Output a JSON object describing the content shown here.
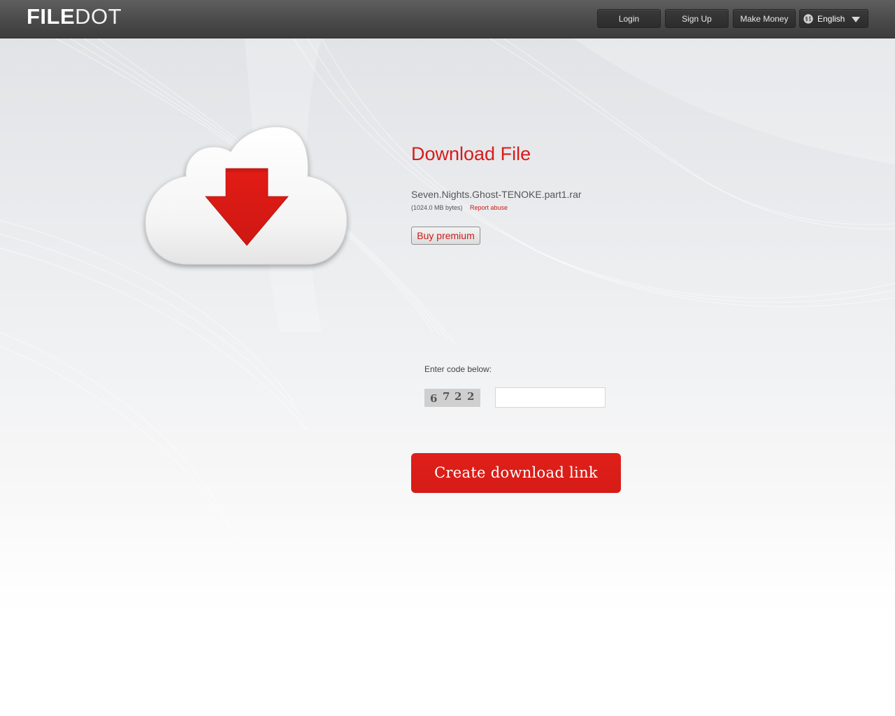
{
  "header": {
    "logo_bold": "FILE",
    "logo_light": "DOT",
    "nav": {
      "login_label": "Login",
      "signup_label": "Sign Up",
      "make_money_label": "Make Money",
      "language_label": "English"
    }
  },
  "main": {
    "title": "Download File",
    "file_name": "Seven.Nights.Ghost-TENOKE.part1.rar",
    "file_size": "(1024.0 MB bytes)",
    "report_label": "Report abuse",
    "buy_premium_label": "Buy premium",
    "code_label": "Enter code below:",
    "captcha_digits": [
      "6",
      "7",
      "2",
      "2"
    ],
    "code_input_value": "",
    "create_link_label": "Create download link"
  },
  "colors": {
    "accent_red": "#d81b1b",
    "header_dark": "#4a4a4a",
    "button_red": "#dd1e18"
  },
  "icons": {
    "globe": "globe-icon",
    "dropdown": "chevron-down-icon",
    "cloud": "cloud-download-icon"
  }
}
